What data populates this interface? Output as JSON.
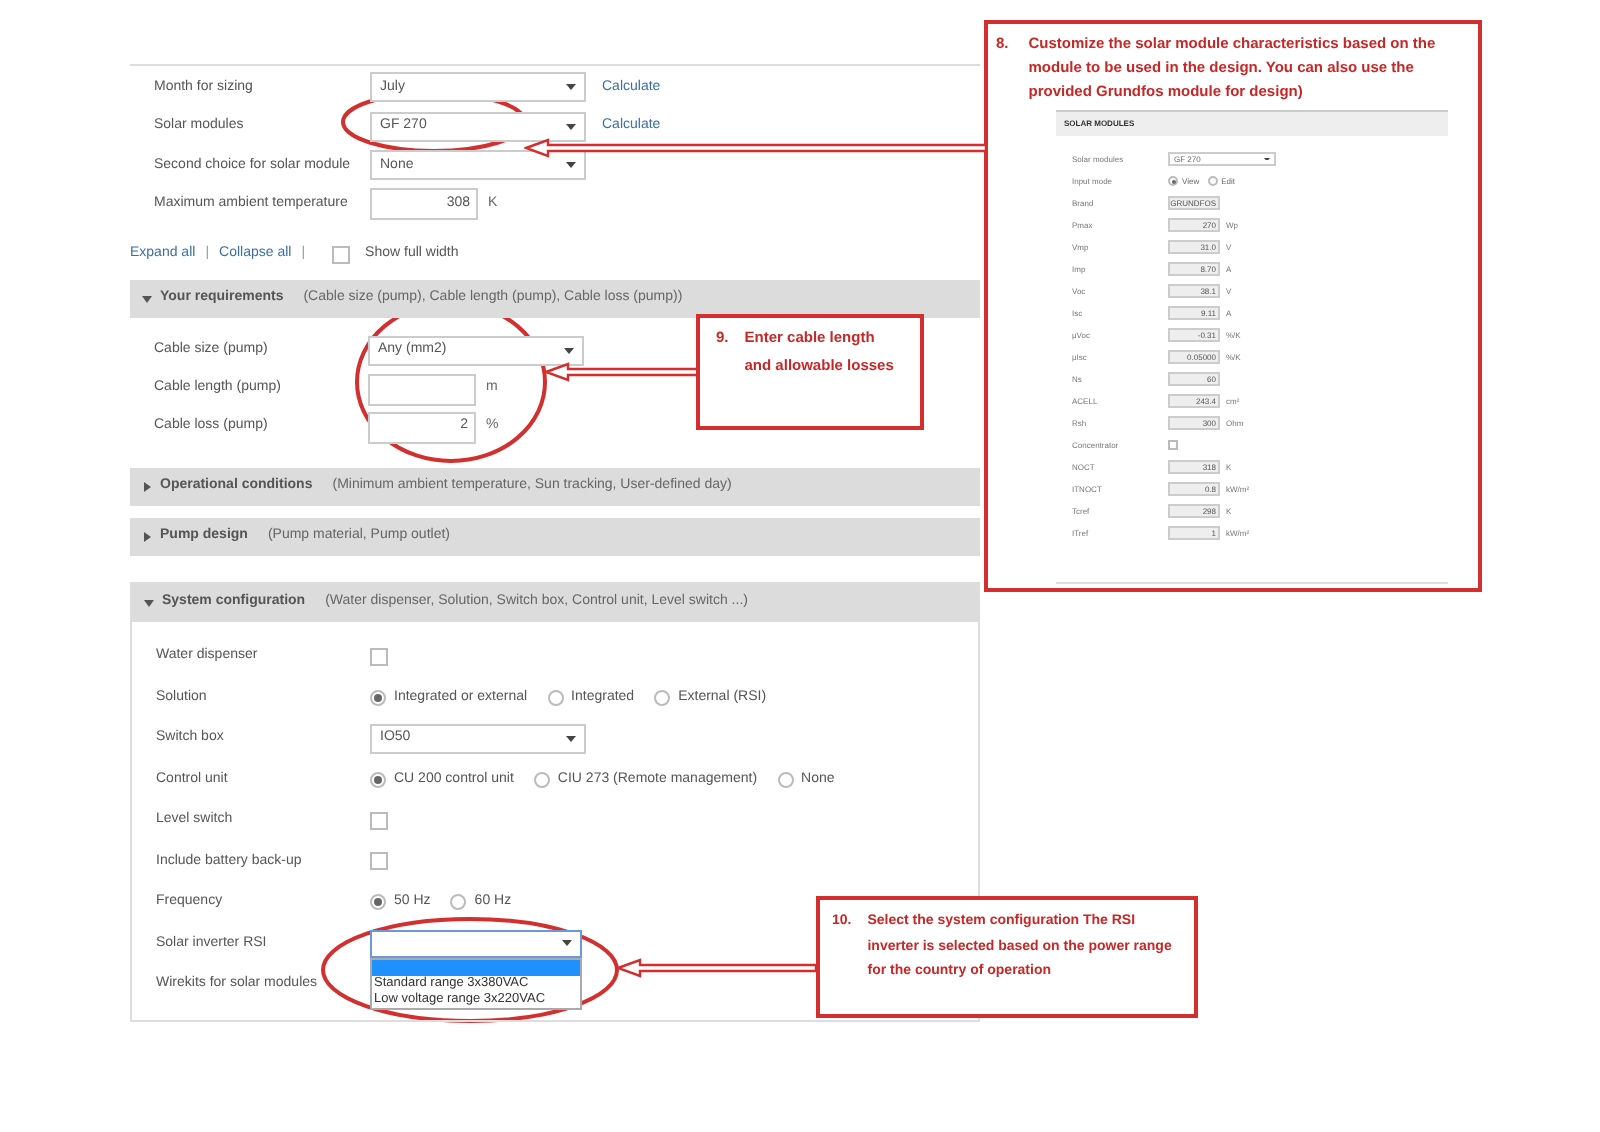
{
  "top_fields": [
    {
      "label": "Month for sizing",
      "kind": "select",
      "value": "July",
      "action": "Calculate"
    },
    {
      "label": "Solar modules",
      "kind": "select",
      "value": "GF 270",
      "action": "Calculate"
    },
    {
      "label": "Second choice for solar module",
      "kind": "select",
      "value": "None"
    },
    {
      "label": "Maximum ambient temperature",
      "kind": "number",
      "value": "308",
      "unit": "K"
    }
  ],
  "links": {
    "expand_all": "Expand all",
    "separator": "|",
    "collapse_all": "Collapse all",
    "separator_2": "|"
  },
  "show_full_width": {
    "label": "Show full width",
    "checked": false
  },
  "sections": [
    {
      "title": "Your requirements",
      "summary": "(Cable size (pump), Cable length (pump), Cable loss (pump))",
      "expanded": true,
      "rows": [
        {
          "label": "Cable size (pump)",
          "kind": "select",
          "value": "Any (mm2)"
        },
        {
          "label": "Cable length (pump)",
          "kind": "number",
          "unit": "m"
        },
        {
          "label": "Cable loss (pump)",
          "kind": "number",
          "value": "2",
          "unit": "%"
        }
      ]
    },
    {
      "title": "Operational conditions",
      "summary": "(Minimum ambient temperature, Sun tracking, User-defined day)",
      "expanded": false
    },
    {
      "title": "Pump design",
      "summary": "(Pump material, Pump outlet)",
      "expanded": false
    },
    {
      "title": "System configuration",
      "summary": "(Water dispenser, Solution, Switch box, Control unit, Level switch ...)",
      "expanded": true,
      "rows": [
        {
          "label": "Water dispenser",
          "kind": "checkbox",
          "checked": false
        },
        {
          "label": "Solution",
          "kind": "radio",
          "options": [
            {
              "label": "Integrated or external",
              "selected": true
            },
            {
              "label": "Integrated",
              "selected": false
            },
            {
              "label": "External (RSI)",
              "selected": false
            }
          ]
        },
        {
          "label": "Switch box",
          "kind": "select",
          "value": "IO50"
        },
        {
          "label": "Control unit",
          "kind": "radio",
          "options": [
            {
              "label": "CU 200 control unit",
              "selected": true
            },
            {
              "label": "CIU 273 (Remote management)",
              "selected": false
            },
            {
              "label": "None",
              "selected": false
            }
          ]
        },
        {
          "label": "Level switch",
          "kind": "checkbox",
          "checked": false
        },
        {
          "label": "Include battery back-up",
          "kind": "checkbox",
          "checked": false
        },
        {
          "label": "Frequency",
          "kind": "radio",
          "options": [
            {
              "label": "50 Hz",
              "selected": true
            },
            {
              "label": "60 Hz",
              "selected": false
            }
          ]
        },
        {
          "label": "Solar inverter RSI",
          "kind": "open_select",
          "options": [
            {
              "selected": true
            },
            {
              "label": "Standard range 3x380VAC",
              "selected": false
            },
            {
              "label": "Low voltage range 3x220VAC",
              "selected": false
            }
          ]
        },
        {
          "label": "Wirekits for solar modules",
          "kind": "empty"
        }
      ]
    }
  ],
  "callouts": [
    {
      "number": "8.",
      "text": "Customize the solar module characteristics based on the module to be used in the design. You can also use the provided Grundfos module for design)"
    },
    {
      "number": "9.",
      "text": "Enter cable length and allowable losses"
    },
    {
      "number": "10.",
      "text": "Select the system configuration The RSI inverter is selected based on the power range for the country of operation"
    }
  ],
  "inset": {
    "title": "SOLAR MODULES",
    "rows": [
      {
        "label": "Solar modules",
        "kind": "select",
        "value": "GF 270"
      },
      {
        "label": "Input mode",
        "kind": "radio",
        "options": [
          {
            "label": "View",
            "selected": true
          },
          {
            "label": "Edit",
            "selected": false
          }
        ]
      },
      {
        "label": "Brand",
        "kind": "field",
        "value": "GRUNDFOS"
      },
      {
        "label": "Pmax",
        "kind": "field",
        "value": "270",
        "unit": "Wp"
      },
      {
        "label": "Vmp",
        "kind": "field",
        "value": "31.0",
        "unit": "V"
      },
      {
        "label": "Imp",
        "kind": "field",
        "value": "8.70",
        "unit": "A"
      },
      {
        "label": "Voc",
        "kind": "field",
        "value": "38.1",
        "unit": "V"
      },
      {
        "label": "Isc",
        "kind": "field",
        "value": "9.11",
        "unit": "A"
      },
      {
        "label": "μVoc",
        "kind": "field",
        "value": "-0.31",
        "unit": "%/K"
      },
      {
        "label": "μIsc",
        "kind": "field",
        "value": "0.05000",
        "unit": "%/K"
      },
      {
        "label": "Ns",
        "kind": "field",
        "value": "60"
      },
      {
        "label": "ACELL",
        "kind": "field",
        "value": "243.4",
        "unit": "cm²"
      },
      {
        "label": "Rsh",
        "kind": "field",
        "value": "300",
        "unit": "Ohm"
      },
      {
        "label": "Concentrator",
        "kind": "checkbox",
        "checked": false
      },
      {
        "label": "NOCT",
        "kind": "field",
        "value": "318",
        "unit": "K"
      },
      {
        "label": "ITNOCT",
        "kind": "field",
        "value": "0.8",
        "unit": "kW/m²"
      },
      {
        "label": "Tcref",
        "kind": "field",
        "value": "298",
        "unit": "K"
      },
      {
        "label": "ITref",
        "kind": "field",
        "value": "1",
        "unit": "kW/m²"
      }
    ]
  }
}
